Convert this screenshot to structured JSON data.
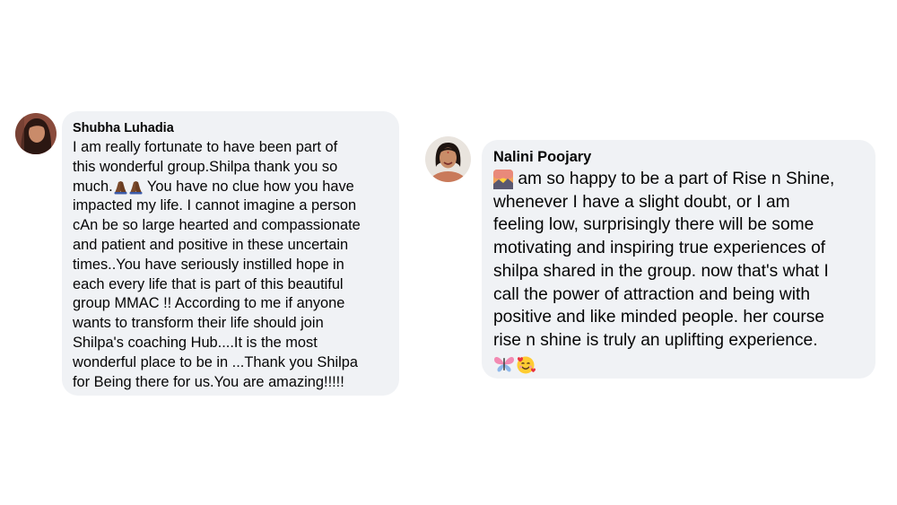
{
  "comments": [
    {
      "author": "Shubha Luhadia",
      "avatar_icon": "profile-photo-woman-dark-hair",
      "lines": [
        "I am really fortunate to have been part of",
        "this wonderful group.Shilpa thank you so",
        "much.",
        " You have no clue how you have",
        "impacted my life. I cannot imagine a person",
        "cAn be so large hearted and compassionate",
        "and patient and positive in these uncertain",
        "times..You have seriously instilled hope in",
        "each every life that is part of this beautiful",
        "group MMAC !! According to me if anyone",
        "wants to transform their life should join",
        "Shilpa's coaching Hub....It is the most",
        "wonderful place to be in ...Thank you Shilpa",
        "for Being there for us.You are amazing!!!!!"
      ],
      "emojis": [
        "folded-hands-icon",
        "folded-hands-icon"
      ]
    },
    {
      "author": "Nalini Poojary",
      "avatar_icon": "profile-photo-woman-smiling",
      "lines": [
        " am so happy to be a part of Rise n Shine,",
        "whenever I have a slight doubt, or I am",
        "feeling low, surprisingly there will be some",
        "motivating and inspiring true experiences of",
        "shilpa shared in the group. now that's what I",
        "call the power of attraction and being with",
        "positive and like minded people. her course",
        "rise n shine is truly an uplifting experience."
      ],
      "emojis": [
        "sunrise-icon",
        "butterfly-icon",
        "smiling-face-with-hearts-icon"
      ]
    }
  ],
  "colors": {
    "bubble_background": "#f0f2f5",
    "text": "#050505",
    "page_background": "#ffffff"
  }
}
